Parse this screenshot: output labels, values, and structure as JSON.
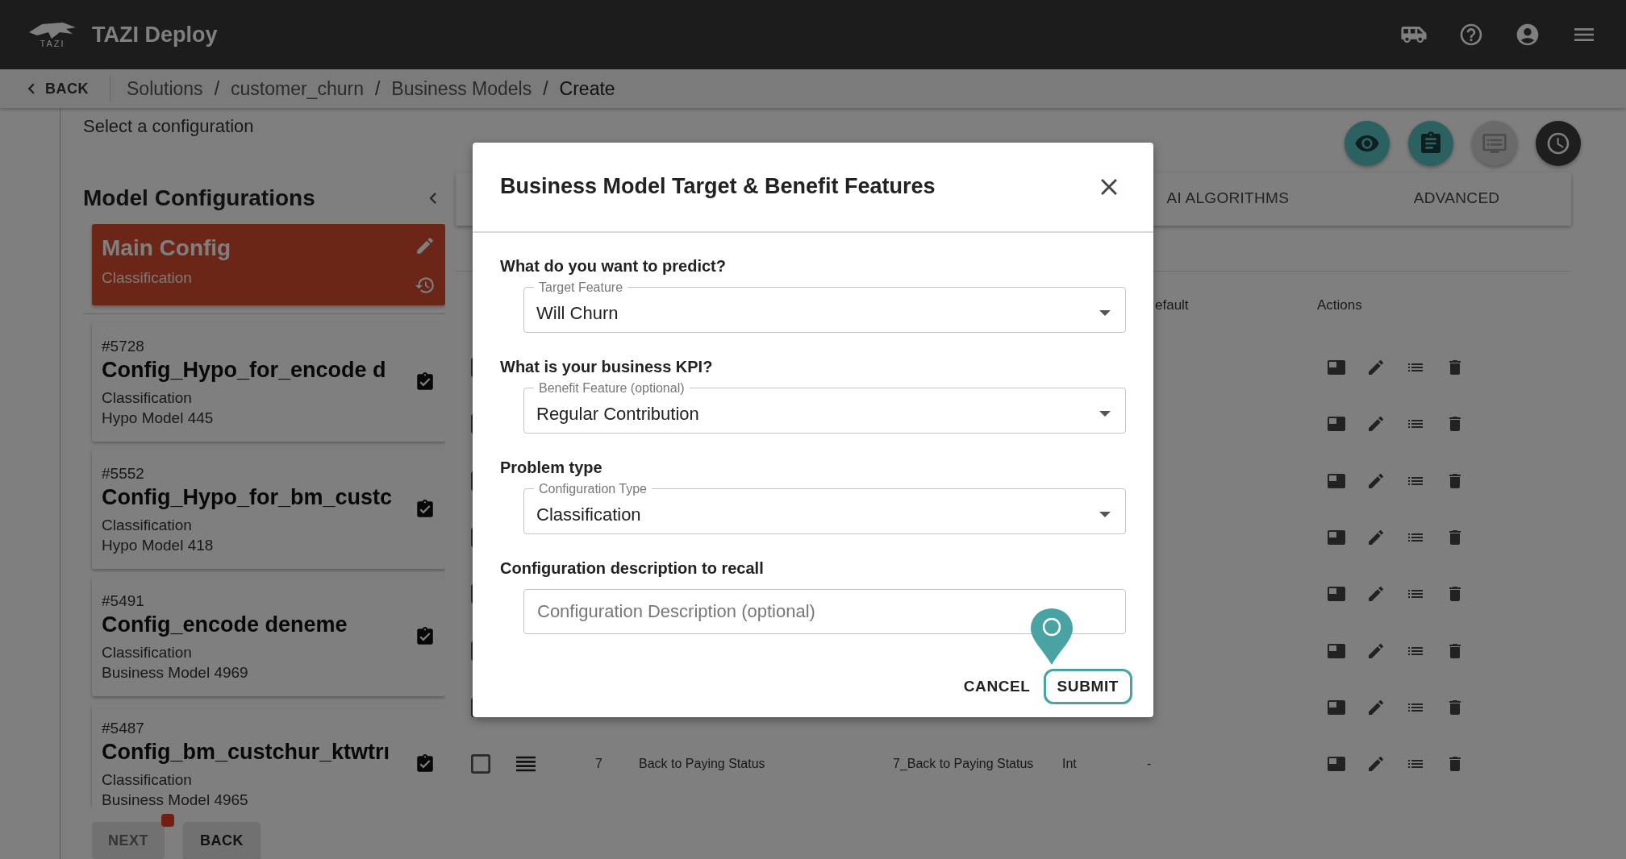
{
  "app": {
    "logo_text": "TAZI",
    "title": "TAZI Deploy"
  },
  "breadcrumb": {
    "back": "BACK",
    "separator": "/",
    "items": [
      "Solutions",
      "customer_churn",
      "Business Models",
      "Create"
    ]
  },
  "instruction": "Select a configuration",
  "toolbar": [
    {
      "kind": "eye",
      "disabled": false
    },
    {
      "kind": "clipboard",
      "disabled": false
    },
    {
      "kind": "monitor",
      "disabled": true
    },
    {
      "kind": "clock",
      "disabled": false
    }
  ],
  "configurations": {
    "title": "Model Configurations",
    "items": [
      {
        "kind": "main",
        "name": "Main Config",
        "type": "Classification",
        "selected": true
      },
      {
        "kind": "saved",
        "id": "#5728",
        "name": "Config_Hypo_for_encode d",
        "type": "Classification",
        "model": "Hypo Model 445",
        "selected": false
      },
      {
        "kind": "saved",
        "id": "#5552",
        "name": "Config_Hypo_for_bm_custc",
        "type": "Classification",
        "model": "Hypo Model 418",
        "selected": false
      },
      {
        "kind": "saved",
        "id": "#5491",
        "name": "Config_encode deneme",
        "type": "Classification",
        "model": "Business Model 4969",
        "selected": false
      },
      {
        "kind": "saved",
        "id": "#5487",
        "name": "Config_bm_custchur_ktwtrı",
        "type": "Classification",
        "model": "Business Model 4965",
        "selected": false
      }
    ]
  },
  "footer_buttons": [
    {
      "label": "NEXT",
      "disabled": true,
      "badge": true
    },
    {
      "label": "BACK",
      "disabled": false,
      "badge": false
    }
  ],
  "tabs": [
    {
      "label": "AI ALGORITHMS",
      "selected": false
    },
    {
      "label": "ADVANCED",
      "selected": false
    }
  ],
  "table": {
    "columns": [
      "efault",
      "Actions"
    ],
    "rows": [
      {
        "kind": "covered",
        "checked": false
      },
      {
        "kind": "covered",
        "checked": false
      },
      {
        "kind": "covered",
        "checked": false
      },
      {
        "kind": "covered",
        "checked": false
      },
      {
        "kind": "covered",
        "checked": false
      },
      {
        "kind": "covered",
        "checked": false
      },
      {
        "kind": "covered",
        "checked": false
      },
      {
        "kind": "data",
        "checked": false,
        "cells": [
          "7",
          "Back to Paying Status",
          "7_Back to Paying Status",
          "Int",
          "-"
        ]
      }
    ]
  },
  "modal": {
    "title": "Business Model Target & Benefit Features",
    "fields": [
      {
        "kind": "select",
        "question": "What do you want to predict?",
        "label": "Target Feature",
        "value": "Will Churn"
      },
      {
        "kind": "select",
        "question": "What is your business KPI?",
        "label": "Benefit Feature (optional)",
        "value": "Regular Contribution"
      },
      {
        "kind": "select",
        "question": "Problem type",
        "label": "Configuration Type",
        "value": "Classification"
      },
      {
        "kind": "text",
        "question": "Configuration description to recall",
        "placeholder": "Configuration Description (optional)"
      }
    ],
    "buttons": [
      {
        "label": "CANCEL",
        "kind": "text"
      },
      {
        "label": "SUBMIT",
        "kind": "outlined"
      }
    ]
  }
}
